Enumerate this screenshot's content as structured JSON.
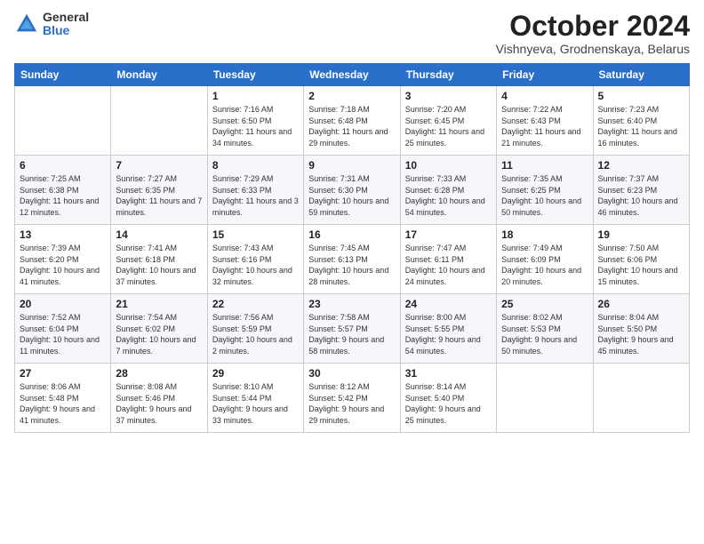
{
  "logo": {
    "general": "General",
    "blue": "Blue"
  },
  "header": {
    "month": "October 2024",
    "location": "Vishnyeva, Grodnenskaya, Belarus"
  },
  "days_of_week": [
    "Sunday",
    "Monday",
    "Tuesday",
    "Wednesday",
    "Thursday",
    "Friday",
    "Saturday"
  ],
  "weeks": [
    [
      {
        "day": "",
        "sunrise": "",
        "sunset": "",
        "daylight": ""
      },
      {
        "day": "",
        "sunrise": "",
        "sunset": "",
        "daylight": ""
      },
      {
        "day": "1",
        "sunrise": "Sunrise: 7:16 AM",
        "sunset": "Sunset: 6:50 PM",
        "daylight": "Daylight: 11 hours and 34 minutes."
      },
      {
        "day": "2",
        "sunrise": "Sunrise: 7:18 AM",
        "sunset": "Sunset: 6:48 PM",
        "daylight": "Daylight: 11 hours and 29 minutes."
      },
      {
        "day": "3",
        "sunrise": "Sunrise: 7:20 AM",
        "sunset": "Sunset: 6:45 PM",
        "daylight": "Daylight: 11 hours and 25 minutes."
      },
      {
        "day": "4",
        "sunrise": "Sunrise: 7:22 AM",
        "sunset": "Sunset: 6:43 PM",
        "daylight": "Daylight: 11 hours and 21 minutes."
      },
      {
        "day": "5",
        "sunrise": "Sunrise: 7:23 AM",
        "sunset": "Sunset: 6:40 PM",
        "daylight": "Daylight: 11 hours and 16 minutes."
      }
    ],
    [
      {
        "day": "6",
        "sunrise": "Sunrise: 7:25 AM",
        "sunset": "Sunset: 6:38 PM",
        "daylight": "Daylight: 11 hours and 12 minutes."
      },
      {
        "day": "7",
        "sunrise": "Sunrise: 7:27 AM",
        "sunset": "Sunset: 6:35 PM",
        "daylight": "Daylight: 11 hours and 7 minutes."
      },
      {
        "day": "8",
        "sunrise": "Sunrise: 7:29 AM",
        "sunset": "Sunset: 6:33 PM",
        "daylight": "Daylight: 11 hours and 3 minutes."
      },
      {
        "day": "9",
        "sunrise": "Sunrise: 7:31 AM",
        "sunset": "Sunset: 6:30 PM",
        "daylight": "Daylight: 10 hours and 59 minutes."
      },
      {
        "day": "10",
        "sunrise": "Sunrise: 7:33 AM",
        "sunset": "Sunset: 6:28 PM",
        "daylight": "Daylight: 10 hours and 54 minutes."
      },
      {
        "day": "11",
        "sunrise": "Sunrise: 7:35 AM",
        "sunset": "Sunset: 6:25 PM",
        "daylight": "Daylight: 10 hours and 50 minutes."
      },
      {
        "day": "12",
        "sunrise": "Sunrise: 7:37 AM",
        "sunset": "Sunset: 6:23 PM",
        "daylight": "Daylight: 10 hours and 46 minutes."
      }
    ],
    [
      {
        "day": "13",
        "sunrise": "Sunrise: 7:39 AM",
        "sunset": "Sunset: 6:20 PM",
        "daylight": "Daylight: 10 hours and 41 minutes."
      },
      {
        "day": "14",
        "sunrise": "Sunrise: 7:41 AM",
        "sunset": "Sunset: 6:18 PM",
        "daylight": "Daylight: 10 hours and 37 minutes."
      },
      {
        "day": "15",
        "sunrise": "Sunrise: 7:43 AM",
        "sunset": "Sunset: 6:16 PM",
        "daylight": "Daylight: 10 hours and 32 minutes."
      },
      {
        "day": "16",
        "sunrise": "Sunrise: 7:45 AM",
        "sunset": "Sunset: 6:13 PM",
        "daylight": "Daylight: 10 hours and 28 minutes."
      },
      {
        "day": "17",
        "sunrise": "Sunrise: 7:47 AM",
        "sunset": "Sunset: 6:11 PM",
        "daylight": "Daylight: 10 hours and 24 minutes."
      },
      {
        "day": "18",
        "sunrise": "Sunrise: 7:49 AM",
        "sunset": "Sunset: 6:09 PM",
        "daylight": "Daylight: 10 hours and 20 minutes."
      },
      {
        "day": "19",
        "sunrise": "Sunrise: 7:50 AM",
        "sunset": "Sunset: 6:06 PM",
        "daylight": "Daylight: 10 hours and 15 minutes."
      }
    ],
    [
      {
        "day": "20",
        "sunrise": "Sunrise: 7:52 AM",
        "sunset": "Sunset: 6:04 PM",
        "daylight": "Daylight: 10 hours and 11 minutes."
      },
      {
        "day": "21",
        "sunrise": "Sunrise: 7:54 AM",
        "sunset": "Sunset: 6:02 PM",
        "daylight": "Daylight: 10 hours and 7 minutes."
      },
      {
        "day": "22",
        "sunrise": "Sunrise: 7:56 AM",
        "sunset": "Sunset: 5:59 PM",
        "daylight": "Daylight: 10 hours and 2 minutes."
      },
      {
        "day": "23",
        "sunrise": "Sunrise: 7:58 AM",
        "sunset": "Sunset: 5:57 PM",
        "daylight": "Daylight: 9 hours and 58 minutes."
      },
      {
        "day": "24",
        "sunrise": "Sunrise: 8:00 AM",
        "sunset": "Sunset: 5:55 PM",
        "daylight": "Daylight: 9 hours and 54 minutes."
      },
      {
        "day": "25",
        "sunrise": "Sunrise: 8:02 AM",
        "sunset": "Sunset: 5:53 PM",
        "daylight": "Daylight: 9 hours and 50 minutes."
      },
      {
        "day": "26",
        "sunrise": "Sunrise: 8:04 AM",
        "sunset": "Sunset: 5:50 PM",
        "daylight": "Daylight: 9 hours and 45 minutes."
      }
    ],
    [
      {
        "day": "27",
        "sunrise": "Sunrise: 8:06 AM",
        "sunset": "Sunset: 5:48 PM",
        "daylight": "Daylight: 9 hours and 41 minutes."
      },
      {
        "day": "28",
        "sunrise": "Sunrise: 8:08 AM",
        "sunset": "Sunset: 5:46 PM",
        "daylight": "Daylight: 9 hours and 37 minutes."
      },
      {
        "day": "29",
        "sunrise": "Sunrise: 8:10 AM",
        "sunset": "Sunset: 5:44 PM",
        "daylight": "Daylight: 9 hours and 33 minutes."
      },
      {
        "day": "30",
        "sunrise": "Sunrise: 8:12 AM",
        "sunset": "Sunset: 5:42 PM",
        "daylight": "Daylight: 9 hours and 29 minutes."
      },
      {
        "day": "31",
        "sunrise": "Sunrise: 8:14 AM",
        "sunset": "Sunset: 5:40 PM",
        "daylight": "Daylight: 9 hours and 25 minutes."
      },
      {
        "day": "",
        "sunrise": "",
        "sunset": "",
        "daylight": ""
      },
      {
        "day": "",
        "sunrise": "",
        "sunset": "",
        "daylight": ""
      }
    ]
  ]
}
